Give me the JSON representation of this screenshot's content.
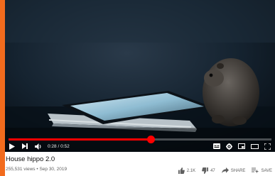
{
  "player": {
    "time_current": "0:28",
    "time_total": "0:52",
    "time_display": "0:28 / 0:52",
    "progress_fraction": 0.54,
    "controls": {
      "play_icon": "play-icon",
      "next_icon": "next-icon",
      "volume_icon": "volume-icon",
      "subtitles_icon": "subtitles-icon",
      "settings_icon": "gear-icon",
      "miniplayer_icon": "miniplayer-icon",
      "theater_icon": "theater-icon",
      "fullscreen_icon": "fullscreen-icon"
    }
  },
  "video": {
    "title": "House hippo 2.0",
    "meta": "255,531 views • Sep 30, 2019"
  },
  "actions": {
    "like_count": "2.1K",
    "dislike_count": "47",
    "share_label": "SHARE",
    "save_label": "SAVE"
  },
  "colors": {
    "accent": "#ff0000",
    "frame_border": "#f26b1d"
  }
}
